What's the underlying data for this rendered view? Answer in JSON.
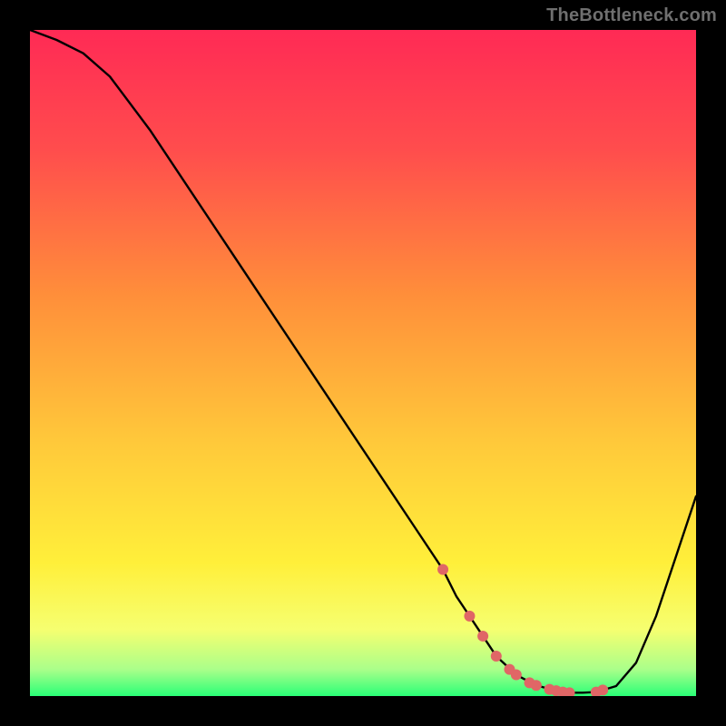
{
  "attribution": "TheBottleneck.com",
  "colors": {
    "background": "#000000",
    "gradient_stops": [
      {
        "offset": "0%",
        "color": "#ff2a55"
      },
      {
        "offset": "18%",
        "color": "#ff4d4d"
      },
      {
        "offset": "40%",
        "color": "#ff8f3a"
      },
      {
        "offset": "62%",
        "color": "#ffc93a"
      },
      {
        "offset": "80%",
        "color": "#ffef3a"
      },
      {
        "offset": "90%",
        "color": "#f6ff70"
      },
      {
        "offset": "96%",
        "color": "#aaff8a"
      },
      {
        "offset": "100%",
        "color": "#2aff77"
      }
    ],
    "curve": "#000000",
    "marker": "#e06666"
  },
  "chart_data": {
    "type": "line",
    "title": "",
    "xlabel": "",
    "ylabel": "",
    "xlim": [
      0,
      100
    ],
    "ylim": [
      0,
      100
    ],
    "series": [
      {
        "name": "bottleneck-curve",
        "x": [
          0,
          4,
          8,
          12,
          18,
          24,
          30,
          36,
          42,
          48,
          54,
          58,
          62,
          64,
          66,
          68,
          70,
          73,
          76,
          79,
          81,
          83,
          85,
          88,
          91,
          94,
          97,
          100
        ],
        "y": [
          100,
          98.5,
          96.5,
          93,
          85,
          76,
          67,
          58,
          49,
          40,
          31,
          25,
          19,
          15,
          12,
          9,
          6,
          3.2,
          1.6,
          0.8,
          0.5,
          0.5,
          0.6,
          1.5,
          5,
          12,
          21,
          30
        ]
      }
    ],
    "markers": {
      "name": "highlight-points",
      "color": "#e06666",
      "radius_px": 6,
      "x": [
        62,
        66,
        68,
        70,
        72,
        73,
        75,
        76,
        78,
        79,
        80,
        81,
        85,
        86
      ],
      "y": [
        19,
        12,
        9,
        6,
        4,
        3.2,
        2,
        1.6,
        1.0,
        0.8,
        0.6,
        0.5,
        0.6,
        0.9
      ]
    }
  }
}
